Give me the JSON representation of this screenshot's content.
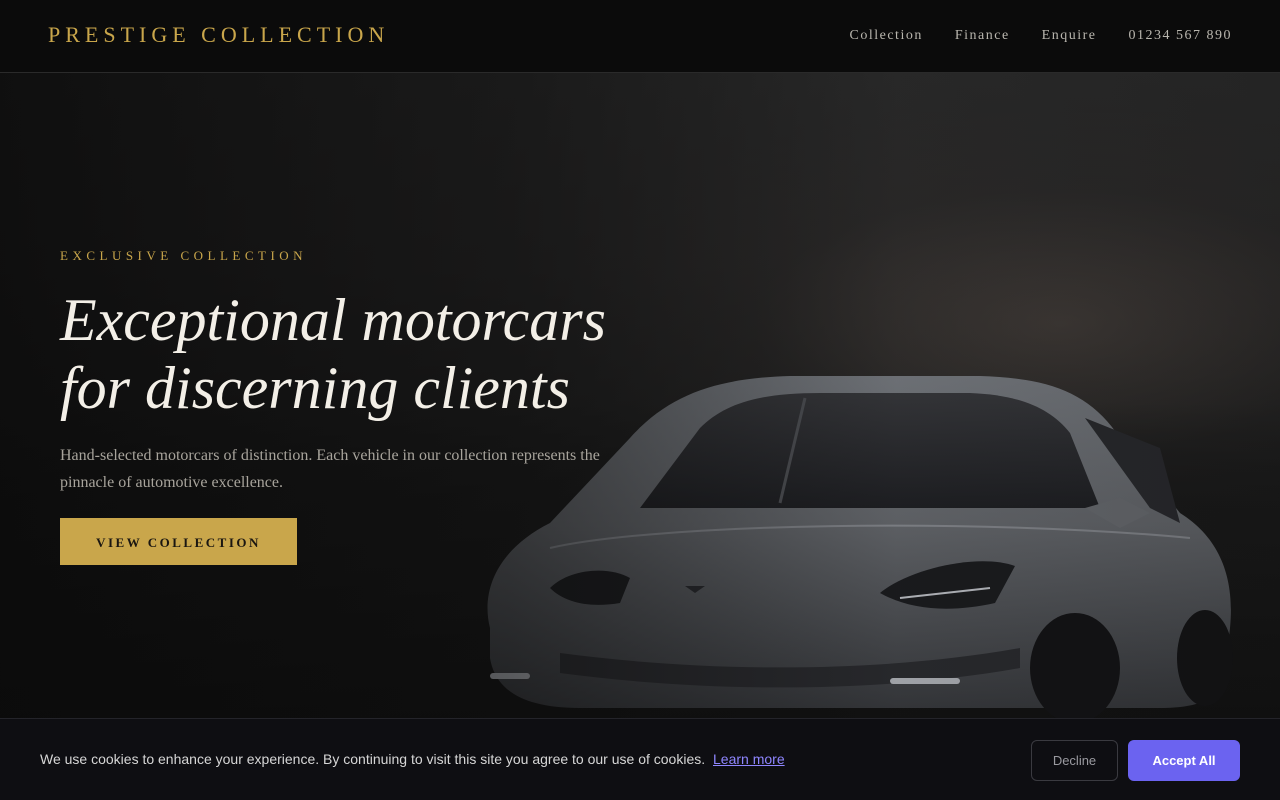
{
  "header": {
    "brand": "PRESTIGE COLLECTION",
    "nav": [
      {
        "label": "Collection"
      },
      {
        "label": "Finance"
      },
      {
        "label": "Enquire"
      },
      {
        "label": "01234 567 890"
      }
    ]
  },
  "hero": {
    "eyebrow": "EXCLUSIVE COLLECTION",
    "headline_line1": "Exceptional motorcars",
    "headline_line2": "for discerning clients",
    "lead": "Hand-selected motorcars of distinction. Each vehicle in our collection represents the pinnacle of automotive excellence.",
    "cta_label": "VIEW COLLECTION"
  },
  "cookie_banner": {
    "message": "We use cookies to enhance your experience. By continuing to visit this site you agree to our use of cookies.",
    "learn_more": "Learn more",
    "decline_label": "Decline",
    "accept_label": "Accept All"
  },
  "colors": {
    "accent_gold": "#c9a64b",
    "accept_button": "#6b63f0",
    "background": "#0b0b0b"
  }
}
